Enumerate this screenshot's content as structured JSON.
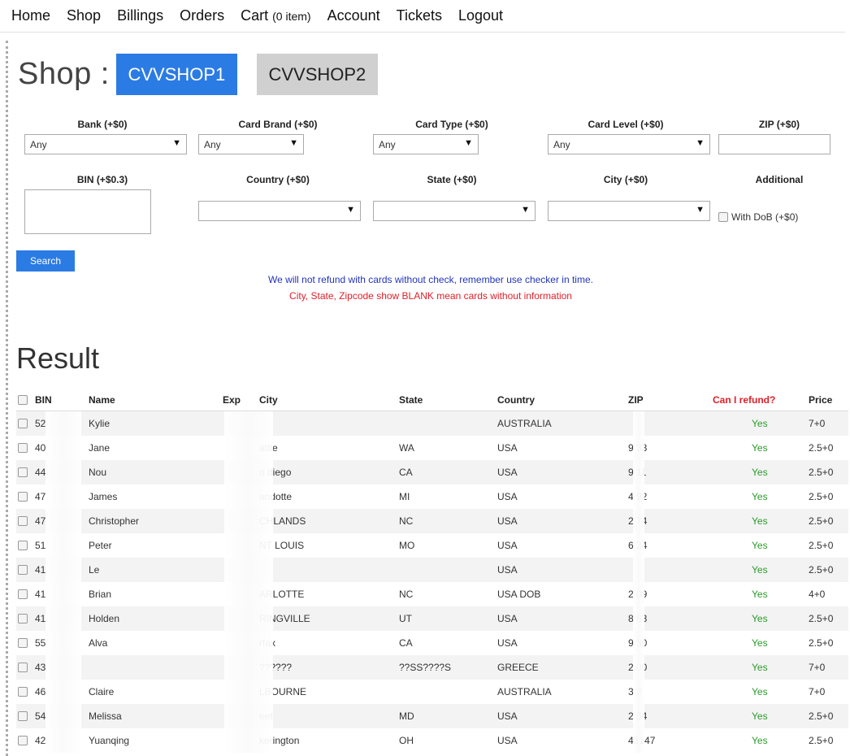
{
  "nav": {
    "items": [
      "Home",
      "Shop",
      "Billings",
      "Orders"
    ],
    "cart_label": "Cart",
    "cart_count": "(0 item)",
    "items_after": [
      "Account",
      "Tickets",
      "Logout"
    ]
  },
  "shop": {
    "title": "Shop :",
    "shops": [
      "CVVSHOP1",
      "CVVSHOP2"
    ],
    "active_shop": "CVVSHOP1"
  },
  "filters": {
    "bank": {
      "label": "Bank (+$0)",
      "value": "Any"
    },
    "card_brand": {
      "label": "Card Brand (+$0)",
      "value": "Any"
    },
    "card_type": {
      "label": "Card Type (+$0)",
      "value": "Any"
    },
    "card_level": {
      "label": "Card Level (+$0)",
      "value": "Any"
    },
    "zip": {
      "label": "ZIP (+$0)",
      "value": ""
    },
    "bin": {
      "label": "BIN (+$0.3)",
      "value": ""
    },
    "country": {
      "label": "Country  (+$0)",
      "value": ""
    },
    "state": {
      "label": "State  (+$0)",
      "value": ""
    },
    "city": {
      "label": "City (+$0)",
      "value": ""
    },
    "additional": {
      "label": "Additional"
    },
    "with_dob": {
      "label": "With DoB",
      "price": "(+$0)"
    }
  },
  "search_label": "Search",
  "notices": {
    "blue": "We will not refund with cards without check, remember use checker in time.",
    "red": "City, State, Zipcode show BLANK mean cards without information"
  },
  "result_title": "Result",
  "table": {
    "headers": {
      "bin": "BIN",
      "name": "Name",
      "exp": "Exp",
      "city": "City",
      "state": "State",
      "country": "Country",
      "zip": "ZIP",
      "refund": "Can I refund?",
      "price": "Price"
    },
    "rows": [
      {
        "bin": "52",
        "name": "Kylie",
        "city": "",
        "state": "",
        "country": "AUSTRALIA",
        "zip": "",
        "refund": "Yes",
        "price": "7+0"
      },
      {
        "bin": "40",
        "name": "Jane",
        "city": "attle",
        "state": "WA",
        "country": "USA",
        "zip": "9 33",
        "refund": "Yes",
        "price": "2.5+0"
      },
      {
        "bin": "44",
        "name": "Nou",
        "city": "n diego",
        "state": "CA",
        "country": "USA",
        "zip": "9 11",
        "refund": "Yes",
        "price": "2.5+0"
      },
      {
        "bin": "47",
        "name": "James",
        "city": "andotte",
        "state": "MI",
        "country": "USA",
        "zip": "4 92",
        "refund": "Yes",
        "price": "2.5+0"
      },
      {
        "bin": "47",
        "name": "Christopher",
        "city": "CHLANDS",
        "state": "NC",
        "country": "USA",
        "zip": "2 74",
        "refund": "Yes",
        "price": "2.5+0"
      },
      {
        "bin": "51",
        "name": "Peter",
        "city": "NT LOUIS",
        "state": "MO",
        "country": "USA",
        "zip": "6 24",
        "refund": "Yes",
        "price": "2.5+0"
      },
      {
        "bin": "41",
        "name": "Le",
        "city": "",
        "state": "",
        "country": "USA",
        "zip": "",
        "refund": "Yes",
        "price": "2.5+0"
      },
      {
        "bin": "41",
        "name": "Brian",
        "city": "ARLOTTE",
        "state": "NC",
        "country": "USA DOB",
        "zip": "2 09",
        "refund": "Yes",
        "price": "4+0"
      },
      {
        "bin": "41",
        "name": "Holden",
        "city": "RINGVILLE",
        "state": "UT",
        "country": "USA",
        "zip": "8 63",
        "refund": "Yes",
        "price": "2.5+0"
      },
      {
        "bin": "55",
        "name": "Alva",
        "city": "rfax",
        "state": "CA",
        "country": "USA",
        "zip": "9 30",
        "refund": "Yes",
        "price": "2.5+0"
      },
      {
        "bin": "43",
        "name": "",
        "city": "??????",
        "state": "??SS????S",
        "country": "GREECE",
        "zip": "2 00",
        "refund": "Yes",
        "price": "7+0"
      },
      {
        "bin": "46",
        "name": "Claire",
        "city": "LBOURNE",
        "state": "",
        "country": "AUSTRALIA",
        "zip": "3 2",
        "refund": "Yes",
        "price": "7+0"
      },
      {
        "bin": "54",
        "name": "Melissa",
        "city": "eet",
        "state": "MD",
        "country": "USA",
        "zip": "2 54",
        "refund": "Yes",
        "price": "2.5+0"
      },
      {
        "bin": "42",
        "name": "Yuanqing",
        "city": "kerington",
        "state": "OH",
        "country": "USA",
        "zip": "43147",
        "refund": "Yes",
        "price": "2.5+0"
      }
    ]
  }
}
